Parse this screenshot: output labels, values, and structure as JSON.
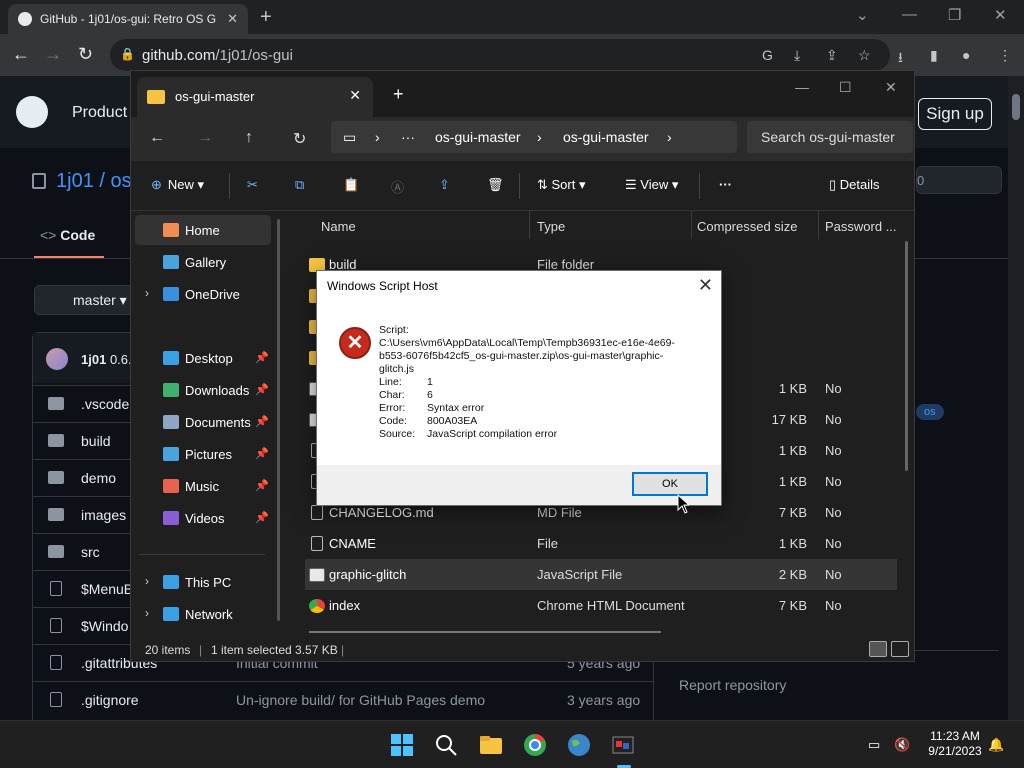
{
  "browser": {
    "tab_title": "GitHub - 1j01/os-gui: Retro OS G",
    "url_host": "github.com",
    "url_path": "/1j01/os-gui"
  },
  "github": {
    "product_label": "Product",
    "signup_label": "Sign up",
    "repo_owner": "1j01",
    "repo_name_partial": "os",
    "code_tab": "Code",
    "branch": "master",
    "commit_user": "1j01",
    "commit_version": "0.6.",
    "star_count": "0",
    "topic_badge": "os",
    "report_link": "Report repository",
    "rows": [
      {
        "name": ".vscode",
        "type": "folder",
        "msg": "",
        "age": ""
      },
      {
        "name": "build",
        "type": "folder",
        "msg": "",
        "age": ""
      },
      {
        "name": "demo",
        "type": "folder",
        "msg": "",
        "age": ""
      },
      {
        "name": "images",
        "type": "folder",
        "msg": "",
        "age": ""
      },
      {
        "name": "src",
        "type": "folder",
        "msg": "",
        "age": ""
      },
      {
        "name": "$MenuB",
        "type": "file",
        "msg": "",
        "age": ""
      },
      {
        "name": "$Windo",
        "type": "file",
        "msg": "",
        "age": ""
      },
      {
        "name": ".gitattributes",
        "type": "file",
        "msg": "Initial commit",
        "age": "5 years ago"
      },
      {
        "name": ".gitignore",
        "type": "file",
        "msg": "Un-ignore build/ for GitHub Pages demo",
        "age": "3 years ago"
      }
    ]
  },
  "explorer": {
    "tab_title": "os-gui-master",
    "path": [
      "os-gui-master",
      "os-gui-master"
    ],
    "search_placeholder": "Search os-gui-master",
    "cmd": {
      "new": "New",
      "sort": "Sort",
      "view": "View",
      "details": "Details"
    },
    "nav": [
      {
        "label": "Home",
        "icon": "home-icon",
        "color": "#f28b54",
        "selected": true
      },
      {
        "label": "Gallery",
        "icon": "gallery-icon",
        "color": "#4aa3df"
      },
      {
        "label": "OneDrive",
        "icon": "onedrive-icon",
        "color": "#3b8fe0",
        "expandable": true
      },
      {
        "label": "Desktop",
        "icon": "desktop-icon",
        "color": "#3aa0e6",
        "pinned": true
      },
      {
        "label": "Downloads",
        "icon": "downloads-icon",
        "color": "#3fb06d",
        "pinned": true
      },
      {
        "label": "Documents",
        "icon": "documents-icon",
        "color": "#8fa7c2",
        "pinned": true
      },
      {
        "label": "Pictures",
        "icon": "pictures-icon",
        "color": "#4aa3df",
        "pinned": true
      },
      {
        "label": "Music",
        "icon": "music-icon",
        "color": "#e7624f",
        "pinned": true
      },
      {
        "label": "Videos",
        "icon": "videos-icon",
        "color": "#8a5cd6",
        "pinned": true
      },
      {
        "label": "This PC",
        "icon": "this-pc-icon",
        "color": "#3aa0e6",
        "expandable": true
      },
      {
        "label": "Network",
        "icon": "network-icon",
        "color": "#3aa0e6",
        "expandable": true
      }
    ],
    "columns": {
      "name": "Name",
      "type": "Type",
      "size": "Compressed size",
      "password": "Password ..."
    },
    "files": [
      {
        "name": "build",
        "type": "File folder",
        "size": "",
        "pw": "",
        "icon": "folder"
      },
      {
        "name": "",
        "type": "",
        "size": "",
        "pw": "",
        "icon": "folder"
      },
      {
        "name": "",
        "type": "",
        "size": "",
        "pw": "",
        "icon": "folder"
      },
      {
        "name": "",
        "type": "",
        "size": "",
        "pw": "",
        "icon": "folder"
      },
      {
        "name": "",
        "type": "",
        "size": "1 KB",
        "pw": "No",
        "icon": "js"
      },
      {
        "name": "",
        "type": "",
        "size": "17 KB",
        "pw": "No",
        "icon": "js"
      },
      {
        "name": "",
        "type": "",
        "size": "1 KB",
        "pw": "No",
        "icon": "file"
      },
      {
        "name": "",
        "type": "",
        "size": "1 KB",
        "pw": "No",
        "icon": "file"
      },
      {
        "name": "CHANGELOG.md",
        "type": "MD File",
        "size": "7 KB",
        "pw": "No",
        "icon": "file"
      },
      {
        "name": "CNAME",
        "type": "File",
        "size": "1 KB",
        "pw": "No",
        "icon": "file"
      },
      {
        "name": "graphic-glitch",
        "type": "JavaScript File",
        "size": "2 KB",
        "pw": "No",
        "icon": "js",
        "selected": true
      },
      {
        "name": "index",
        "type": "Chrome HTML Document",
        "size": "7 KB",
        "pw": "No",
        "icon": "chrome"
      }
    ],
    "status_count": "20 items",
    "status_selected": "1 item selected  3.57 KB"
  },
  "dialog": {
    "title": "Windows Script Host",
    "script_label": "Script:",
    "script_path_1": "C:\\Users\\vm6\\AppData\\Local\\Temp\\Tempb36931ec-e16e-4e69-",
    "script_path_2": "b553-6076f5b42cf5_os-gui-master.zip\\os-gui-master\\graphic-",
    "script_path_3": "glitch.js",
    "line_label": "Line:",
    "line": "1",
    "char_label": "Char:",
    "char": "6",
    "error_label": "Error:",
    "error": "Syntax error",
    "code_label": "Code:",
    "code": "800A03EA",
    "source_label": "Source:",
    "source": "JavaScript compilation error",
    "ok": "OK"
  },
  "taskbar": {
    "time": "11:23 AM",
    "date": "9/21/2023"
  },
  "colors": {
    "accent_link": "#4493f8",
    "error_red": "#c42b1c",
    "dialog_focus": "#0078d7"
  }
}
